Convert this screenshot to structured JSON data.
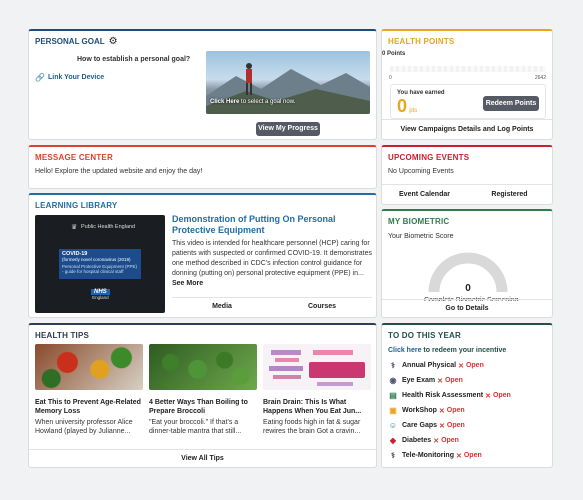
{
  "personal_goal": {
    "title": "PERSONAL GOAL",
    "question": "How to establish a personal goal?",
    "link_device": "Link Your Device",
    "image_caption_bold": "Click Here",
    "image_caption_rest": " to select a goal now.",
    "progress_button": "View My Progress"
  },
  "health_points": {
    "title": "HEALTH POINTS",
    "points_label": "0 Points",
    "axis_min": "0",
    "axis_max": "2642",
    "progress_fraction": 0,
    "earned_label": "You have earned",
    "earned_value": "0",
    "earned_unit": "pts",
    "redeem_button": "Redeem Points",
    "footer_link": "View Campaigns Details and Log Points"
  },
  "message_center": {
    "title": "MESSAGE CENTER",
    "message": "Hello! Explore the updated website and enjoy the day!"
  },
  "upcoming_events": {
    "title": "UPCOMING EVENTS",
    "message": "No Upcoming Events",
    "tab_calendar": "Event Calendar",
    "tab_registered": "Registered"
  },
  "learning_library": {
    "title": "LEARNING LIBRARY",
    "video_header": "Public Health England",
    "video_line1": "COVID-19",
    "video_line2": "(formerly novel coronavirus (2019)",
    "video_line3": "Personal Protective Equipment (PPE)",
    "video_line4": "- guide for hospital clinical staff",
    "video_badge_top": "NHS",
    "video_badge_bottom": "England",
    "article_title": "Demonstration of Putting On Personal Protective Equipment",
    "article_body": "This video is intended for healthcare personnel (HCP) caring for patients with suspected or confirmed COVID-19. It demonstrates one method described in CDC's infection control guidance for donning (putting on) personal protective equipment (PPE) in...",
    "see_more": "See More",
    "tab_media": "Media",
    "tab_courses": "Courses"
  },
  "my_biometric": {
    "title": "MY BIOMETRIC",
    "score_label": "Your Biometric Score",
    "score_value": "0",
    "score_fraction": 0,
    "cutoff_text": "Complete Biometric Screening",
    "footer_link": "Go to Details"
  },
  "health_tips": {
    "title": "HEALTH TIPS",
    "tips": [
      {
        "title": "Eat This to Prevent Age-Related Memory Loss",
        "desc": "When university professor Alice Howland (played by Julianne..."
      },
      {
        "title": "4 Better Ways Than Boiling to Prepare Broccoli",
        "desc": "\"Eat your broccoli.\" If that's a dinner-table mantra that still..."
      },
      {
        "title": "Brain Drain: This Is What Happens When You Eat Jun...",
        "desc": "Eating foods high in fat & sugar rewires the brain Got a cravin..."
      }
    ],
    "footer_link": "View All Tips"
  },
  "todo": {
    "title": "TO DO THIS YEAR",
    "incentive_prefix": "Click here",
    "incentive_rest": " to redeem your incentive",
    "status_x": "✕",
    "status_open": "Open",
    "items": [
      {
        "label": "Annual Physical",
        "icon": "stethoscope-icon"
      },
      {
        "label": "Eye Exam",
        "icon": "eye-icon"
      },
      {
        "label": "Health Risk Assessment",
        "icon": "clipboard-icon"
      },
      {
        "label": "WorkShop",
        "icon": "workshop-icon"
      },
      {
        "label": "Care Gaps",
        "icon": "doctor-icon"
      },
      {
        "label": "Diabetes",
        "icon": "diabetes-icon"
      },
      {
        "label": "Tele-Monitoring",
        "icon": "stethoscope-icon"
      }
    ]
  },
  "colors": {
    "personal_goal": "#1f4d7a",
    "health_points": "#e8a620",
    "message_center": "#d6452a",
    "upcoming_events": "#c8202f",
    "learning_library": "#1e6fa8",
    "my_biometric": "#2e7d4f",
    "health_tips": "#2f3f55",
    "todo": "#244f4a"
  }
}
